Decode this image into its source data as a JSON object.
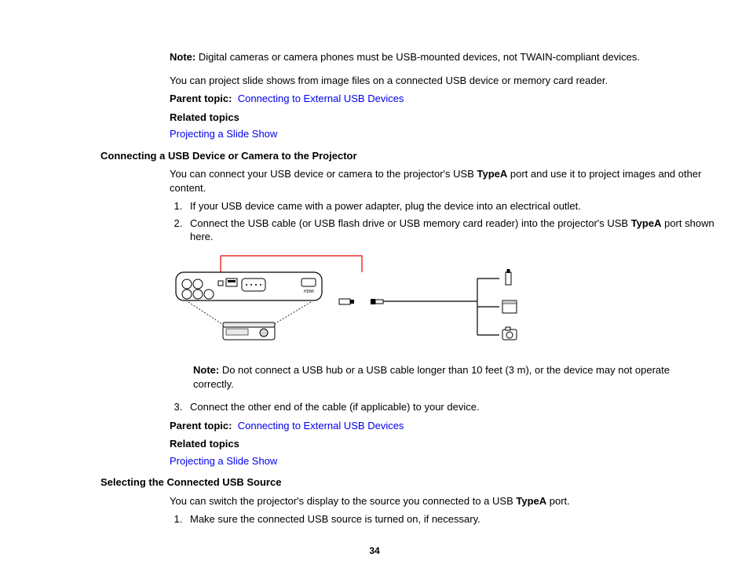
{
  "note1_label": "Note:",
  "note1_text": " Digital cameras or camera phones must be USB-mounted devices, not TWAIN-compliant devices.",
  "para_slideshows": "You can project slide shows from image files on a connected USB device or memory card reader.",
  "parent_topic_label": "Parent topic:",
  "parent_topic_link": "Connecting to External USB Devices",
  "related_topics_label": "Related topics",
  "link_slideshow": "Projecting a Slide Show",
  "heading_connect": "Connecting a USB Device or Camera to the Projector",
  "para_connect_intro_a": "You can connect your USB device or camera to the projector's USB ",
  "para_connect_intro_bold": "TypeA",
  "para_connect_intro_b": " port and use it to project images and other content.",
  "step1": "If your USB device came with a power adapter, plug the device into an electrical outlet.",
  "step2_a": "Connect the USB cable (or USB flash drive or USB memory card reader) into the projector's USB ",
  "step2_bold": "TypeA",
  "step2_b": " port shown here.",
  "note2_label": "Note:",
  "note2_text": " Do not connect a USB hub or a USB cable longer than 10 feet (3 m), or the device may not operate correctly.",
  "step3": "Connect the other end of the cable (if applicable) to your device.",
  "heading_select": "Selecting the Connected USB Source",
  "para_select_a": "You can switch the projector's display to the source you connected to a USB ",
  "para_select_bold": "TypeA",
  "para_select_b": " port.",
  "select_step1": "Make sure the connected USB source is turned on, if necessary.",
  "page_number": "34"
}
